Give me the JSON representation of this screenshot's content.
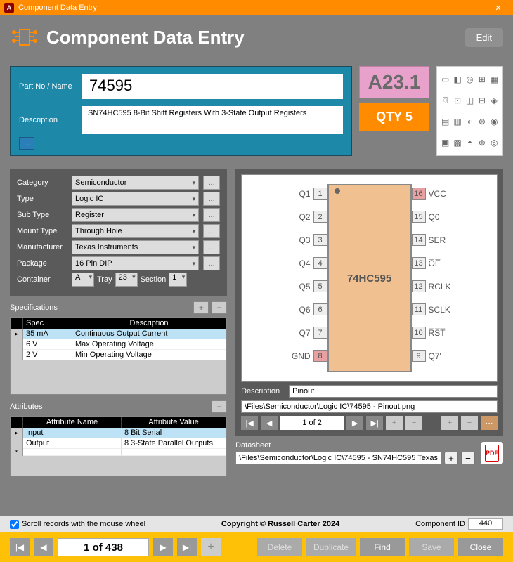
{
  "titlebar": {
    "title": "Component Data Entry",
    "app_icon_text": "A"
  },
  "header": {
    "title": "Component Data Entry",
    "edit_label": "Edit"
  },
  "part": {
    "part_label": "Part No / Name",
    "part_value": "74595",
    "desc_label": "Description",
    "desc_value": "SN74HC595 8-Bit Shift Registers With 3-State Output Registers",
    "more_label": "..."
  },
  "location": {
    "code": "A23.1"
  },
  "qty": {
    "label": "QTY 5"
  },
  "form": {
    "category_label": "Category",
    "category_value": "Semiconductor",
    "type_label": "Type",
    "type_value": "Logic IC",
    "subtype_label": "Sub Type",
    "subtype_value": "Register",
    "mount_label": "Mount Type",
    "mount_value": "Through Hole",
    "mfr_label": "Manufacturer",
    "mfr_value": "Texas Instruments",
    "package_label": "Package",
    "package_value": "16 Pin DIP",
    "container_label": "Container",
    "container_value": "A",
    "tray_label": "Tray",
    "tray_value": "23",
    "section_label": "Section",
    "section_value": "1"
  },
  "specs": {
    "title": "Specifications",
    "col_spec": "Spec",
    "col_desc": "Description",
    "rows": [
      {
        "spec": "35 mA",
        "desc": "Continuous Output Current"
      },
      {
        "spec": "6 V",
        "desc": "Max Operating Voltage"
      },
      {
        "spec": "2 V",
        "desc": "Min Operating Voltage"
      }
    ]
  },
  "attrs": {
    "title": "Attributes",
    "col_name": "Attribute Name",
    "col_val": "Attribute Value",
    "rows": [
      {
        "name": "Input",
        "val": "8 Bit Serial"
      },
      {
        "name": "Output",
        "val": "8 3-State Parallel Outputs"
      }
    ]
  },
  "pinout": {
    "chip_label": "74HC595",
    "left_pins": [
      {
        "label": "Q1",
        "num": "1"
      },
      {
        "label": "Q2",
        "num": "2"
      },
      {
        "label": "Q3",
        "num": "3"
      },
      {
        "label": "Q4",
        "num": "4"
      },
      {
        "label": "Q5",
        "num": "5"
      },
      {
        "label": "Q6",
        "num": "6"
      },
      {
        "label": "Q7",
        "num": "7"
      },
      {
        "label": "GND",
        "num": "8",
        "red": true
      }
    ],
    "right_pins": [
      {
        "label": "VCC",
        "num": "16",
        "red": true
      },
      {
        "label": "Q0",
        "num": "15"
      },
      {
        "label": "SER",
        "num": "14"
      },
      {
        "label": "O̅E̅",
        "num": "13"
      },
      {
        "label": "RCLK",
        "num": "12"
      },
      {
        "label": "SCLK",
        "num": "11"
      },
      {
        "label": "R̅S̅T̅",
        "num": "10"
      },
      {
        "label": "Q7'",
        "num": "9"
      }
    ],
    "desc_label": "Description",
    "desc_value": "Pinout",
    "path_value": "\\Files\\Semiconductor\\Logic IC\\74595 - Pinout.png",
    "page_text": "1 of 2"
  },
  "datasheet": {
    "title": "Datasheet",
    "path_value": "\\Files\\Semiconductor\\Logic IC\\74595 - SN74HC595 Texas"
  },
  "footer1": {
    "scroll_label": "Scroll records with the mouse wheel",
    "copyright": "Copyright © Russell Carter 2024",
    "compid_label": "Component ID",
    "compid_value": "440"
  },
  "footer2": {
    "record_text": "1 of 438",
    "delete_label": "Delete",
    "duplicate_label": "Duplicate",
    "find_label": "Find",
    "save_label": "Save",
    "close_label": "Close"
  }
}
